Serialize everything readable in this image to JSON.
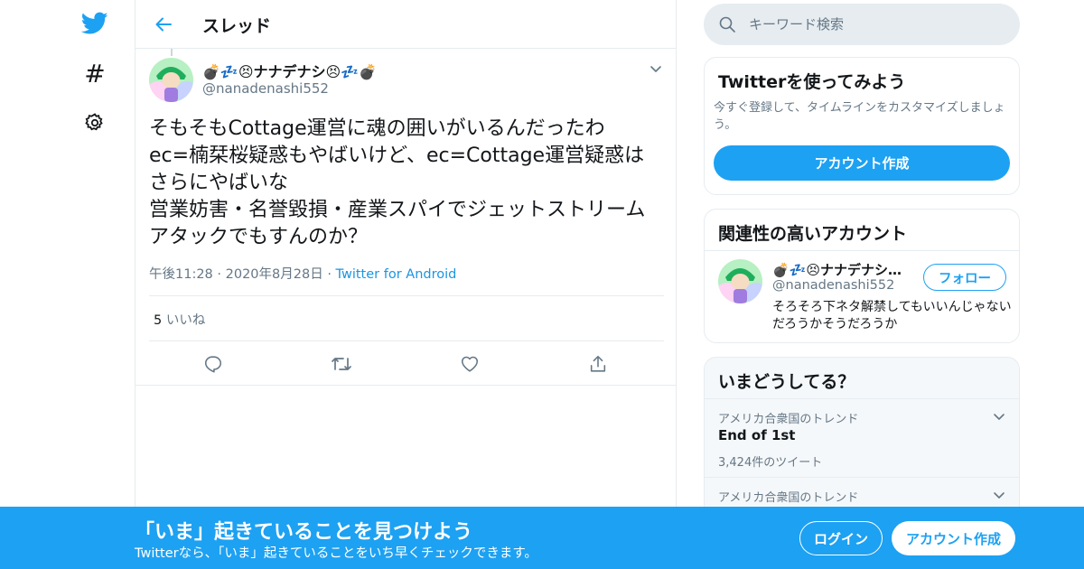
{
  "colors": {
    "accent": "#1da1f2",
    "text": "#14171a",
    "muted": "#657786",
    "border": "#e6ecf0"
  },
  "nav": {
    "icons": [
      "twitter-logo-icon",
      "hashtag-icon",
      "gear-icon"
    ]
  },
  "header": {
    "title": "スレッド"
  },
  "tweet": {
    "display_name": "💣💤😣ナナデナシ😣💤💣",
    "handle": "@nanadenashi552",
    "text": "そもそもCottage運営に魂の囲いがいるんだったわ\nec=楠栞桜疑惑もやばいけど、ec=Cottage運営疑惑はさらにやばいな\n営業妨害・名誉毀損・産業スパイでジェットストリームアタックでもすんのか？",
    "time": "午後11:28",
    "date": "2020年8月28日",
    "source": "Twitter for Android",
    "like_count": "5",
    "like_label": "いいね"
  },
  "search": {
    "placeholder": "キーワード検索"
  },
  "signup_card": {
    "title": "Twitterを使ってみよう",
    "description": "今すぐ登録して、タイムラインをカスタマイズしましょう。",
    "button": "アカウント作成"
  },
  "related_card": {
    "title": "関連性の高いアカウント",
    "account": {
      "display_name": "💣💤😣ナナデナシ😣💤💣",
      "handle": "@nanadenashi552",
      "bio": "そろそろ下ネタ解禁してもいいんじゃないだろうかそうだろうか",
      "follow_label": "フォロー"
    }
  },
  "trends_card": {
    "title": "いまどうしてる？",
    "items": [
      {
        "context": "アメリカ合衆国のトレンド",
        "title": "End of 1st",
        "count": "3,424件のツイート"
      },
      {
        "context": "アメリカ合衆国のトレンド",
        "title": "",
        "count": ""
      }
    ]
  },
  "banner": {
    "title": "「いま」起きていることを見つけよう",
    "subtitle": "Twitterなら、「いま」起きていることをいち早くチェックできます。",
    "login": "ログイン",
    "signup": "アカウント作成"
  }
}
